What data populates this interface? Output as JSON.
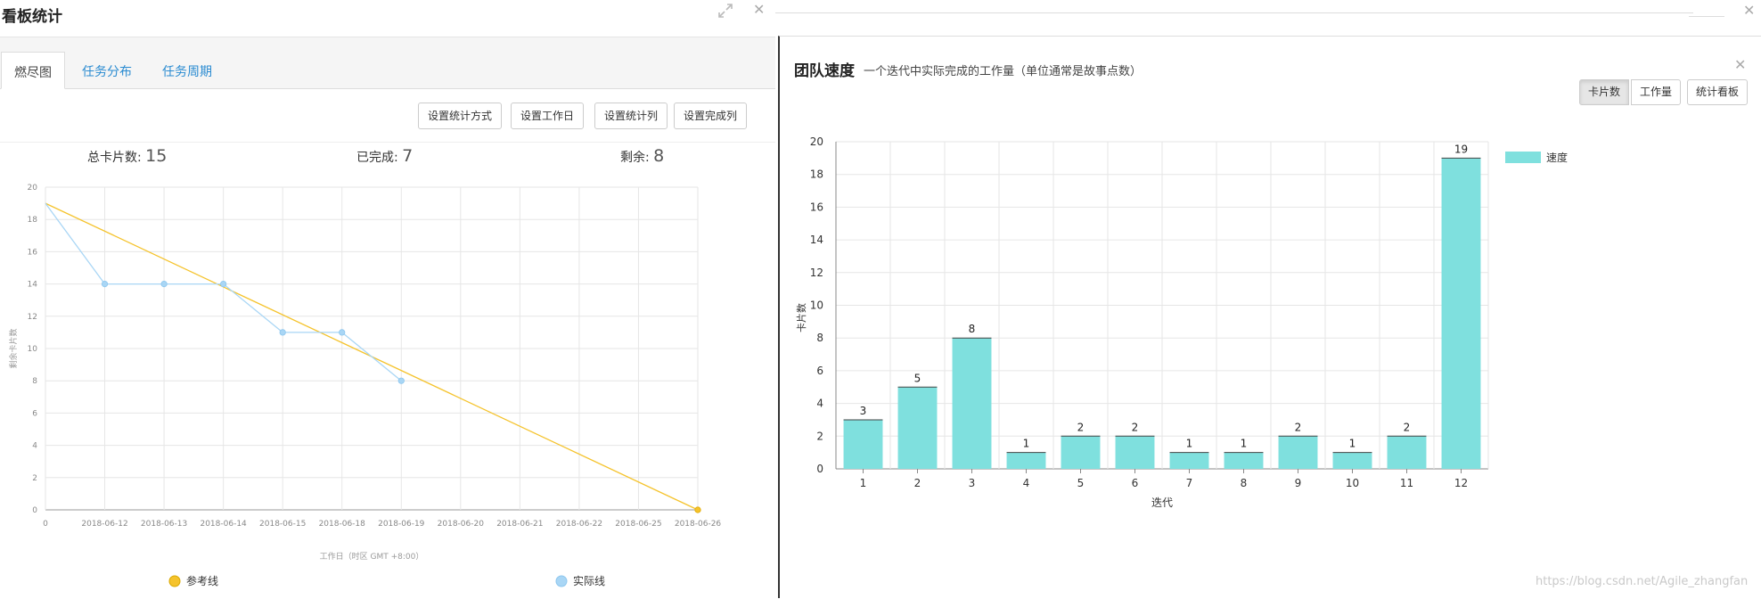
{
  "left_panel": {
    "title": "看板统计",
    "tabs": [
      {
        "label": "燃尽图",
        "active": true
      },
      {
        "label": "任务分布",
        "active": false
      },
      {
        "label": "任务周期",
        "active": false
      }
    ],
    "buttons": [
      "设置统计方式",
      "设置工作日",
      "设置统计列",
      "设置完成列"
    ],
    "stats": {
      "total_label": "总卡片数:",
      "total_value": "15",
      "done_label": "已完成:",
      "done_value": "7",
      "remain_label": "剩余:",
      "remain_value": "8"
    }
  },
  "right_panel": {
    "title": "团队速度",
    "subtitle": "一个迭代中实际完成的工作量（单位通常是故事点数）",
    "buttons": [
      {
        "label": "卡片数",
        "active": true
      },
      {
        "label": "工作量",
        "active": false
      },
      {
        "label": "统计看板",
        "active": false
      }
    ]
  },
  "watermark": "https://blog.csdn.net/Agile_zhangfan",
  "colors": {
    "reference_line": "#f5c32c",
    "actual_line": "#a9d6f5",
    "bar": "#7fe0de",
    "tab_link": "#2a8bd1"
  },
  "chart_data": [
    {
      "type": "line",
      "xlabel": "工作日（时区 GMT +8:00）",
      "ylabel": "剩余卡片数",
      "x": [
        "0",
        "2018-06-12",
        "2018-06-13",
        "2018-06-14",
        "2018-06-15",
        "2018-06-18",
        "2018-06-19",
        "2018-06-20",
        "2018-06-21",
        "2018-06-22",
        "2018-06-25",
        "2018-06-26"
      ],
      "ylim": [
        0,
        20
      ],
      "yticks": [
        0,
        2,
        4,
        6,
        8,
        10,
        12,
        14,
        16,
        18,
        20
      ],
      "grid": true,
      "legend_position": "bottom",
      "series": [
        {
          "name": "参考线",
          "color": "#f5c32c",
          "values": [
            19,
            null,
            null,
            null,
            null,
            null,
            null,
            null,
            null,
            null,
            null,
            0
          ]
        },
        {
          "name": "实际线",
          "color": "#a9d6f5",
          "values": [
            19,
            14,
            14,
            14,
            11,
            11,
            8,
            null,
            null,
            null,
            null,
            null
          ]
        }
      ]
    },
    {
      "type": "bar",
      "xlabel": "迭代",
      "ylabel": "卡片数",
      "categories": [
        "1",
        "2",
        "3",
        "4",
        "5",
        "6",
        "7",
        "8",
        "9",
        "10",
        "11",
        "12"
      ],
      "ylim": [
        0,
        20
      ],
      "yticks": [
        0,
        2,
        4,
        6,
        8,
        10,
        12,
        14,
        16,
        18,
        20
      ],
      "grid": true,
      "legend_position": "top-right",
      "series": [
        {
          "name": "速度",
          "color": "#7fe0de",
          "values": [
            3,
            5,
            8,
            1,
            2,
            2,
            1,
            1,
            2,
            1,
            2,
            19
          ]
        }
      ]
    }
  ]
}
